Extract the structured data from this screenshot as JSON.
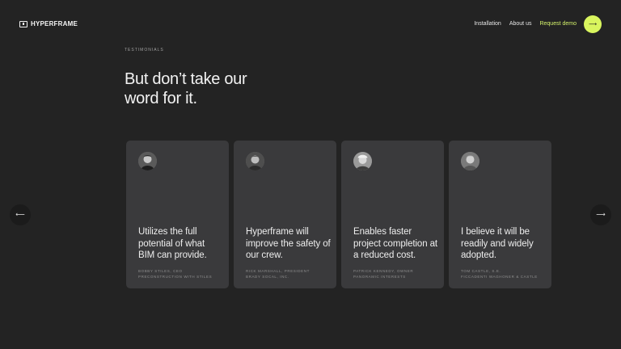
{
  "header": {
    "brand": "HYPERFRAME",
    "nav": [
      {
        "label": "Installation"
      },
      {
        "label": "About us"
      },
      {
        "label": "Request demo"
      }
    ],
    "cta_icon": "arrow-right-icon",
    "accent_color": "#d9f55e"
  },
  "section": {
    "eyebrow": "TESTIMONIALS",
    "headline_line1": "But don’t take our",
    "headline_line2": "word for it."
  },
  "testimonials": [
    {
      "quote": "Utilizes the full potential of what BIM can provide.",
      "author_line1": "BOBBY STILES, CEO",
      "author_line2": "PRECONSTRUCTION WITH STILES"
    },
    {
      "quote": "Hyperframe will improve the safety of our crew.",
      "author_line1": "RICK MARSHALL, PRESIDENT",
      "author_line2": "BRADY SOCAL, INC."
    },
    {
      "quote": "Enables faster project completion at a reduced cost.",
      "author_line1": "PATRICK KENNEDY, OWNER",
      "author_line2": "PANORAMIC INTERESTS"
    },
    {
      "quote": "I believe it will be readily and widely adopted.",
      "author_line1": "TOM CASTLE, S.E.",
      "author_line2": "FICCADENTI WAGHONER & CASTLE"
    }
  ],
  "controls": {
    "prev_icon": "arrow-left-icon",
    "next_icon": "arrow-right-icon"
  }
}
